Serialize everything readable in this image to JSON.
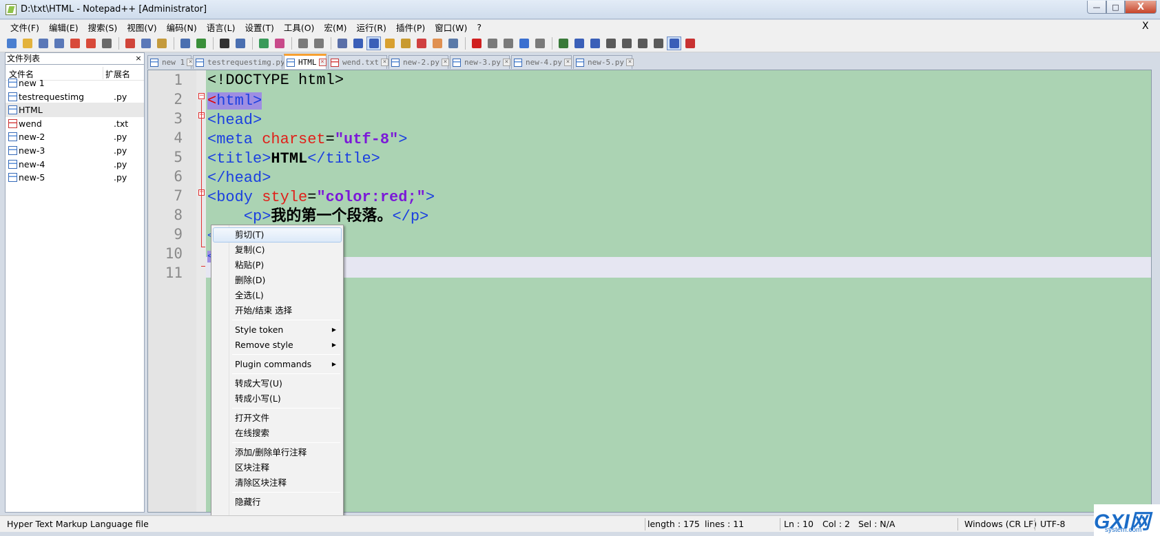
{
  "window": {
    "title": "D:\\txt\\HTML - Notepad++ [Administrator]",
    "min_glyph": "—",
    "max_glyph": "□",
    "close_glyph": "X"
  },
  "menubar": {
    "items": [
      "文件(F)",
      "编辑(E)",
      "搜索(S)",
      "视图(V)",
      "编码(N)",
      "语言(L)",
      "设置(T)",
      "工具(O)",
      "宏(M)",
      "运行(R)",
      "插件(P)",
      "窗口(W)",
      "?"
    ],
    "close_label": "X"
  },
  "toolbar": {
    "buttons": [
      {
        "name": "new-file",
        "color": "#4a7fd0"
      },
      {
        "name": "open-file",
        "color": "#e3b23c"
      },
      {
        "name": "save",
        "color": "#5a78b8"
      },
      {
        "name": "save-all",
        "color": "#5a78b8"
      },
      {
        "name": "close",
        "color": "#d84a3a"
      },
      {
        "name": "close-all",
        "color": "#d84a3a"
      },
      {
        "name": "print",
        "color": "#6a6a6a"
      },
      {
        "sep": true
      },
      {
        "name": "cut",
        "color": "#d0453a"
      },
      {
        "name": "copy",
        "color": "#5a78b8"
      },
      {
        "name": "paste",
        "color": "#c49a3c"
      },
      {
        "sep": true
      },
      {
        "name": "undo",
        "color": "#4a6fb0"
      },
      {
        "name": "redo",
        "color": "#3a8f3a"
      },
      {
        "sep": true
      },
      {
        "name": "find",
        "color": "#333333"
      },
      {
        "name": "replace",
        "color": "#4a6fb0"
      },
      {
        "sep": true
      },
      {
        "name": "zoom-in",
        "color": "#3a9a5a"
      },
      {
        "name": "zoom-out",
        "color": "#c84a8a"
      },
      {
        "sep": true
      },
      {
        "name": "sync-vertical",
        "color": "#7a7a7a"
      },
      {
        "name": "sync-horizontal",
        "color": "#7a7a7a"
      },
      {
        "sep": true
      },
      {
        "name": "word-wrap",
        "color": "#5a6fa8"
      },
      {
        "name": "show-all-chars",
        "color": "#3a5fb8"
      },
      {
        "name": "indent-guide",
        "color": "#3a5fb8",
        "pressed": true
      },
      {
        "name": "udl",
        "color": "#d8a030"
      },
      {
        "name": "doc-map",
        "color": "#c89a30"
      },
      {
        "name": "function-list",
        "color": "#d04040"
      },
      {
        "name": "folder-workspace",
        "color": "#e09050"
      },
      {
        "name": "monitoring",
        "color": "#5a7aa8"
      },
      {
        "sep": true
      },
      {
        "name": "record-macro",
        "color": "#d02020"
      },
      {
        "name": "stop-record",
        "color": "#7a7a7a"
      },
      {
        "name": "play-macro",
        "color": "#7a7a7a"
      },
      {
        "name": "run-macro-multiple",
        "color": "#3a6fd0"
      },
      {
        "name": "save-macro",
        "color": "#7a7a7a"
      },
      {
        "sep": true
      },
      {
        "name": "plugin-a",
        "color": "#3a7a3a"
      },
      {
        "name": "plugin-b",
        "color": "#3a5fb8"
      },
      {
        "name": "plugin-c",
        "color": "#3a5fb8"
      },
      {
        "name": "plugin-d",
        "color": "#5a5a5a"
      },
      {
        "name": "plugin-up",
        "color": "#5a5a5a"
      },
      {
        "name": "plugin-down",
        "color": "#5a5a5a"
      },
      {
        "name": "plugin-e",
        "color": "#5a5a5a"
      },
      {
        "name": "plugin-f",
        "color": "#3a5fb8",
        "pressed": true
      },
      {
        "name": "spell-check",
        "color": "#c83232"
      }
    ]
  },
  "sidepanel": {
    "title": "文件列表",
    "close_glyph": "×",
    "col_name": "文件名",
    "col_ext": "扩展名",
    "files": [
      {
        "name": "new 1",
        "ext": "",
        "red": false
      },
      {
        "name": "testrequestimg",
        "ext": ".py",
        "red": false
      },
      {
        "name": "HTML",
        "ext": "",
        "red": false,
        "selected": true
      },
      {
        "name": "wend",
        "ext": ".txt",
        "red": true
      },
      {
        "name": "new-2",
        "ext": ".py",
        "red": false
      },
      {
        "name": "new-3",
        "ext": ".py",
        "red": false
      },
      {
        "name": "new-4",
        "ext": ".py",
        "red": false
      },
      {
        "name": "new-5",
        "ext": ".py",
        "red": false
      }
    ]
  },
  "tabs": [
    {
      "label": "new 1",
      "red": false
    },
    {
      "label": "testrequestimg.py",
      "red": false
    },
    {
      "label": "HTML",
      "red": false,
      "active": true
    },
    {
      "label": "wend.txt",
      "red": true
    },
    {
      "label": "new-2.py",
      "red": false
    },
    {
      "label": "new-3.py",
      "red": false
    },
    {
      "label": "new-4.py",
      "red": false
    },
    {
      "label": "new-5.py",
      "red": false
    }
  ],
  "tab_close_glyph": "×",
  "editor": {
    "line_numbers": [
      "1",
      "2",
      "3",
      "4",
      "5",
      "6",
      "7",
      "8",
      "9",
      "10",
      "11"
    ],
    "fold_glyph": "−",
    "code": {
      "l1": "<!DOCTYPE html>",
      "l2_open": "<",
      "l2_tag": "html>",
      "l3": "<head>",
      "l4_tag": "<meta",
      "l4_attr": " charset",
      "l4_eq": "=",
      "l4_val": "\"utf-8\"",
      "l4_close": ">",
      "l5_open": "<title>",
      "l5_text": "HTML",
      "l5_close": "</title>",
      "l6": "</head>",
      "l7_tag": "<body",
      "l7_attr": " style",
      "l7_eq": "=",
      "l7_val": "\"color:red;\"",
      "l7_close": ">",
      "l8_open": "    <p>",
      "l8_text": "我的第一个段落。",
      "l8_close": "</p>",
      "l9": "<",
      "l10": "<"
    }
  },
  "context_menu": {
    "groups": [
      [
        "剪切(T)",
        "复制(C)",
        "粘贴(P)",
        "删除(D)",
        "全选(L)",
        "开始/结束 选择"
      ],
      [
        "Style token",
        "Remove style"
      ],
      [
        "Plugin commands"
      ],
      [
        "转成大写(U)",
        "转成小写(L)"
      ],
      [
        "打开文件",
        "在线搜索"
      ],
      [
        "添加/删除单行注释",
        "区块注释",
        "清除区块注释"
      ],
      [
        "隐藏行"
      ]
    ],
    "submenu_items": [
      "Style token",
      "Remove style",
      "Plugin commands"
    ],
    "arrow_glyph": "▶"
  },
  "status": {
    "file_type": "Hyper Text Markup Language file",
    "length": "length : 175",
    "lines": "lines : 11",
    "ln": "Ln : 10",
    "col": "Col : 2",
    "sel": "Sel : N/A",
    "eol": "Windows (CR LF)",
    "encoding": "UTF-8"
  },
  "watermark": {
    "logo": "GXI网",
    "site": "system.com"
  }
}
